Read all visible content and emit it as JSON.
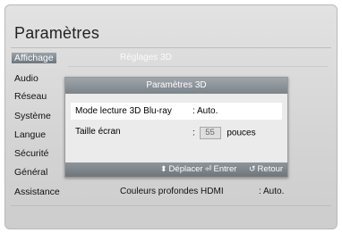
{
  "page_title": "Paramètres",
  "menu": [
    {
      "label": "Affichage",
      "active": true
    },
    {
      "label": "Audio"
    },
    {
      "label": "Réseau"
    },
    {
      "label": "Système"
    },
    {
      "label": "Langue"
    },
    {
      "label": "Sécurité"
    },
    {
      "label": "Général"
    },
    {
      "label": "Assistance"
    }
  ],
  "sub_header": "Réglages 3D",
  "background_row": {
    "label": "Couleurs profondes HDMI",
    "value": ": Auto."
  },
  "dialog": {
    "title": "Paramètres 3D",
    "options": [
      {
        "label": "Mode lecture 3D Blu-ray",
        "value": ": Auto."
      },
      {
        "label": "Taille écran",
        "colon": ":",
        "size": "55",
        "unit": "pouces"
      }
    ],
    "hints": {
      "move": "Déplacer",
      "enter": "Entrer",
      "back": "Retour"
    }
  }
}
